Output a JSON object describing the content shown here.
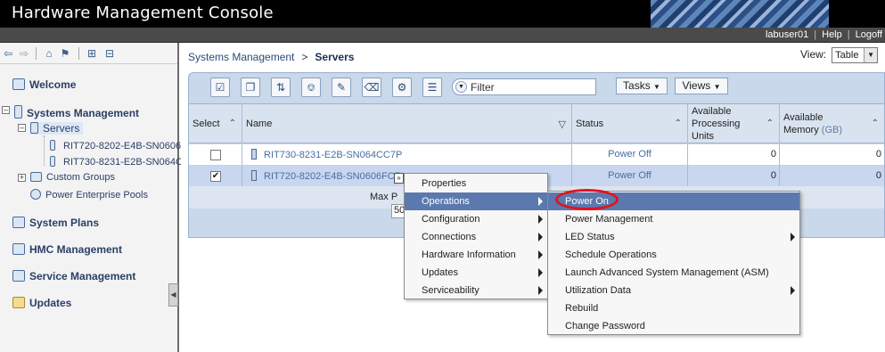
{
  "app": {
    "title": "Hardware Management Console"
  },
  "userbar": {
    "user": "labuser01",
    "help": "Help",
    "logoff": "Logoff"
  },
  "nav": {
    "welcome": "Welcome",
    "systems_management": "Systems Management",
    "servers": "Servers",
    "server1": "RIT720-8202-E4B-SN0606",
    "server2": "RIT730-8231-E2B-SN064C",
    "custom_groups": "Custom Groups",
    "power_pools": "Power Enterprise Pools",
    "system_plans": "System Plans",
    "hmc_management": "HMC Management",
    "service_management": "Service Management",
    "updates": "Updates"
  },
  "breadcrumb": {
    "parent": "Systems Management",
    "sep": ">",
    "current": "Servers"
  },
  "view": {
    "label": "View:",
    "value": "Table"
  },
  "toolbar": {
    "filter_placeholder": "Filter",
    "tasks": "Tasks",
    "views": "Views"
  },
  "table": {
    "headers": {
      "select": "Select",
      "name": "Name",
      "status": "Status",
      "proc": [
        "Available",
        "Processing",
        "Units"
      ],
      "mem": [
        "Available",
        "Memory"
      ],
      "mem_unit": "(GB)"
    },
    "rows": [
      {
        "checked": false,
        "name": "RIT730-8231-E2B-SN064CC7P",
        "status": "Power Off",
        "proc": "0",
        "mem": "0"
      },
      {
        "checked": true,
        "name": "RIT720-8202-E4B-SN0606FCR",
        "status": "Power Off",
        "proc": "0",
        "mem": "0"
      }
    ],
    "max_page_label": "Max P",
    "max_page_value": "50"
  },
  "context_menu": {
    "items": [
      "Properties",
      "Operations",
      "Configuration",
      "Connections",
      "Hardware Information",
      "Updates",
      "Serviceability"
    ]
  },
  "submenu": {
    "items": [
      "Power On",
      "Power Management",
      "LED Status",
      "Schedule Operations",
      "Launch Advanced System Management (ASM)",
      "Utilization Data",
      "Rebuild",
      "Change Password"
    ]
  },
  "colors": {
    "accent": "#5b79ae",
    "highlight_ring": "#e0141e",
    "panel": "#c9d8ea"
  }
}
